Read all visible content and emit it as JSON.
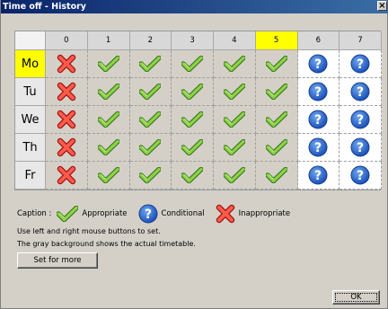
{
  "window": {
    "title": "Time off - History",
    "close_glyph": "×"
  },
  "grid": {
    "columns": [
      "0",
      "1",
      "2",
      "3",
      "4",
      "5",
      "6",
      "7"
    ],
    "selected_column": 5,
    "rows": [
      {
        "label": "Mo",
        "selected": true,
        "cells": [
          "inappropriate",
          "appropriate",
          "appropriate",
          "appropriate",
          "appropriate",
          "appropriate",
          "conditional",
          "conditional"
        ]
      },
      {
        "label": "Tu",
        "selected": false,
        "cells": [
          "inappropriate",
          "appropriate",
          "appropriate",
          "appropriate",
          "appropriate",
          "appropriate",
          "conditional",
          "conditional"
        ]
      },
      {
        "label": "We",
        "selected": false,
        "cells": [
          "inappropriate",
          "appropriate",
          "appropriate",
          "appropriate",
          "appropriate",
          "appropriate",
          "conditional",
          "conditional"
        ]
      },
      {
        "label": "Th",
        "selected": false,
        "cells": [
          "inappropriate",
          "appropriate",
          "appropriate",
          "appropriate",
          "appropriate",
          "appropriate",
          "conditional",
          "conditional"
        ]
      },
      {
        "label": "Fr",
        "selected": false,
        "cells": [
          "inappropriate",
          "appropriate",
          "appropriate",
          "appropriate",
          "appropriate",
          "appropriate",
          "conditional",
          "conditional"
        ]
      }
    ]
  },
  "caption": {
    "label": "Caption :",
    "appropriate": "Appropriate",
    "conditional": "Conditional",
    "inappropriate": "Inappropriate"
  },
  "hints": {
    "line1": "Use left and right mouse buttons to set.",
    "line2": "The gray background shows the actual timetable."
  },
  "buttons": {
    "set_more": "Set for more",
    "ok": "OK"
  },
  "colors": {
    "highlight": "#ffff00",
    "title_start": "#0a246a",
    "title_end": "#3a6ea5"
  }
}
